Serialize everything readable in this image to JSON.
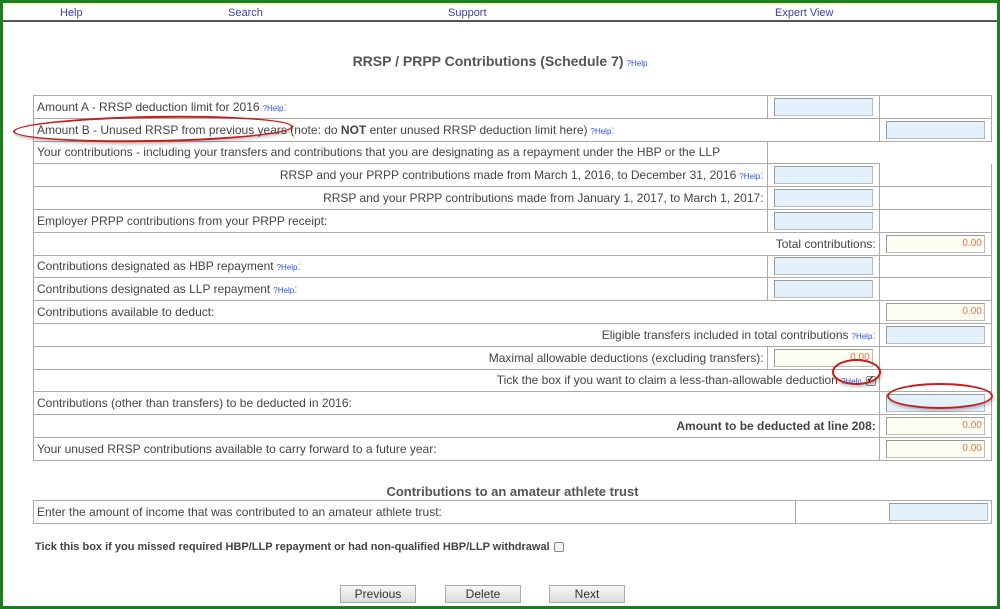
{
  "nav": {
    "help": "Help",
    "search": "Search",
    "support": "Support",
    "expert_view": "Expert View"
  },
  "title": "RRSP / PRPP Contributions (Schedule 7)",
  "help_label": "?Help",
  "colon": ":",
  "rows": {
    "amount_a": "Amount A - RRSP deduction limit for 2016",
    "amount_b_pre": "Amount B - Unused RRSP from previous years (note: do ",
    "amount_b_bold": "NOT",
    "amount_b_post": " enter unused RRSP deduction limit here)",
    "your_contributions": "Your contributions - including your transfers and contributions that you are designating as a repayment under the HBP or the LLP",
    "rrsp_2016": "RRSP and your PRPP contributions made from March 1, 2016, to December 31, 2016",
    "rrsp_2017": "RRSP and your PRPP contributions made from January 1, 2017, to March 1, 2017:",
    "employer_prpp": "Employer PRPP contributions from your PRPP receipt:",
    "total_contributions": "Total contributions:",
    "hbp_repayment": "Contributions designated as HBP repayment",
    "llp_repayment": "Contributions designated as LLP repayment",
    "available_to_deduct": "Contributions available to deduct:",
    "eligible_transfers": "Eligible transfers included in total contributions",
    "maximal_allowable": "Maximal allowable deductions (excluding transfers):",
    "tick_less": "Tick the box if you want to claim a less-than-allowable deduction",
    "to_be_deducted": "Contributions (other than transfers) to be deducted in 2016:",
    "line_208": "Amount to be deducted at line 208:",
    "carry_forward": "Your unused RRSP contributions available to carry forward to a future year:"
  },
  "values": {
    "amount_a": "",
    "amount_b": "",
    "rrsp_2016": "",
    "rrsp_2017": "",
    "employer_prpp": "",
    "total_contributions": "0.00",
    "hbp_repayment": "",
    "llp_repayment": "",
    "available_to_deduct": "0.00",
    "eligible_transfers": "",
    "maximal_allowable": "0.00",
    "less_than_allowable_checked": true,
    "to_be_deducted": "",
    "line_208": "0.00",
    "carry_forward": "0.00"
  },
  "athlete": {
    "title": "Contributions to an amateur athlete trust",
    "label": "Enter the amount of income that was contributed to an amateur athlete trust:",
    "value": ""
  },
  "missed_repayment": {
    "label": "Tick this box if you missed required HBP/LLP repayment or had non-qualified HBP/LLP withdrawal",
    "checked": false
  },
  "buttons": {
    "previous": "Previous",
    "delete": "Delete",
    "next": "Next"
  },
  "colors": {
    "frame": "#1e7d1e",
    "input_editable": "#e3f1fd",
    "input_readonly": "#fdfdf1",
    "computed_value": "#e9734a",
    "help_link": "#2a55e0",
    "annotation": "#c41d1d"
  }
}
